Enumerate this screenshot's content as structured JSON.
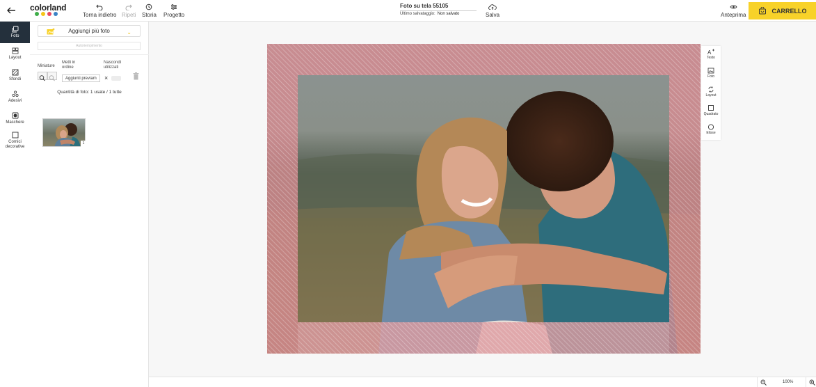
{
  "header": {
    "brand": "colorland",
    "brand_dots": [
      "#3fae49",
      "#f5c518",
      "#e8475f",
      "#3b82c4"
    ],
    "undo_label": "Torna indietro",
    "redo_label": "Ripeti",
    "history_label": "Storia",
    "project_label": "Progetto",
    "project_title": "Foto su tela 55105",
    "last_save_label": "Ultimo salvataggio:",
    "last_save_value": "Non salvato",
    "save_label": "Salva",
    "preview_label": "Anteprima",
    "cart_label": "CARRELLO",
    "cart_color": "#f8d229"
  },
  "nav": {
    "items": [
      {
        "label": "Foto",
        "icon": "photo-icon",
        "active": true
      },
      {
        "label": "Layout",
        "icon": "layout-icon"
      },
      {
        "label": "Sfondi",
        "icon": "background-icon"
      },
      {
        "label": "Adesivi",
        "icon": "sticker-icon"
      },
      {
        "label": "Maschere",
        "icon": "mask-icon"
      },
      {
        "label": "Cornici decorative",
        "icon": "frame-icon"
      }
    ]
  },
  "panel": {
    "add_photos_label": "Aggiungi più foto",
    "autofill_label": "Autoriempimento",
    "thumbnails_label": "Miniature",
    "sort_label": "Metti in ordine",
    "sort_value": "Aggiunti previam",
    "hide_used_label": "Nascondi utilizzati",
    "photo_count": "Quantità di foto: 1 usate / 1 tutte",
    "thumb_badge": "1"
  },
  "tools": {
    "items": [
      {
        "label": "Testo",
        "icon": "text-icon"
      },
      {
        "label": "Foto",
        "icon": "add-photo-icon"
      },
      {
        "label": "Layout",
        "icon": "layout-swap-icon"
      },
      {
        "label": "Quadrato",
        "icon": "square-icon"
      },
      {
        "label": "Elisse",
        "icon": "ellipse-icon"
      }
    ]
  },
  "footer": {
    "zoom": "100%"
  },
  "colors": {
    "nav_active": "#24303c",
    "bleed_overlay": "#d98a91"
  }
}
